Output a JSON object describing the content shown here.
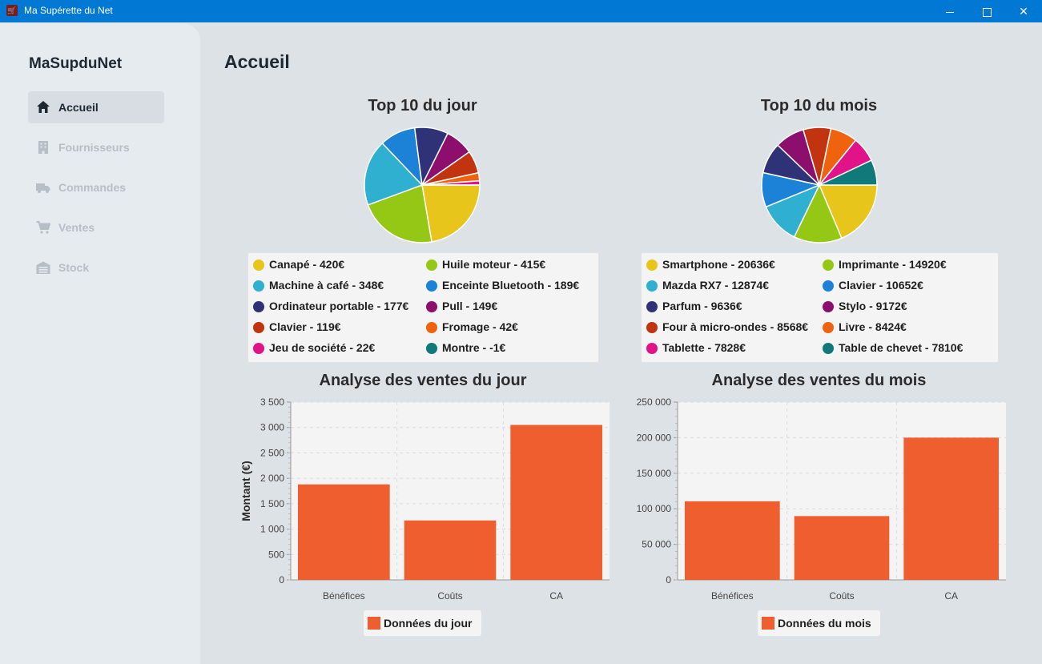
{
  "window": {
    "title": "Ma Supérette du Net"
  },
  "sidebar": {
    "brand": "MaSupduNet",
    "items": [
      {
        "label": "Accueil",
        "icon": "home-icon",
        "active": true
      },
      {
        "label": "Fournisseurs",
        "icon": "building-icon",
        "active": false
      },
      {
        "label": "Commandes",
        "icon": "truck-icon",
        "active": false
      },
      {
        "label": "Ventes",
        "icon": "cart-icon",
        "active": false
      },
      {
        "label": "Stock",
        "icon": "warehouse-icon",
        "active": false
      }
    ]
  },
  "main": {
    "title": "Accueil"
  },
  "colors": {
    "accent": "#0078d4",
    "bar": "#ef5e2e",
    "palette": [
      "#e8c51a",
      "#95c814",
      "#2fb0d0",
      "#1b82d8",
      "#2f3277",
      "#8c0f6e",
      "#c2340f",
      "#f0630e",
      "#e01488",
      "#10797a"
    ]
  },
  "pie_day": {
    "title": "Top 10 du jour",
    "legend": [
      "Canapé - 420€",
      "Huile moteur - 415€",
      "Machine à café - 348€",
      "Enceinte Bluetooth - 189€",
      "Ordinateur portable - 177€",
      "Pull - 149€",
      "Clavier - 119€",
      "Fromage - 42€",
      "Jeu de société - 22€",
      "Montre - -1€"
    ]
  },
  "pie_month": {
    "title": "Top 10 du mois",
    "legend": [
      "Smartphone - 20636€",
      "Imprimante - 14920€",
      "Mazda RX7 - 12874€",
      "Clavier - 10652€",
      "Parfum - 9636€",
      "Stylo - 9172€",
      "Four à micro-ondes - 8568€",
      "Livre - 8424€",
      "Tablette - 7828€",
      "Table de chevet - 7810€"
    ]
  },
  "bar_day": {
    "title": "Analyse des ventes du jour",
    "legend": "Données du jour",
    "ylabel": "Montant (€)",
    "ticks": [
      "0",
      "500",
      "1 000",
      "1 500",
      "2 000",
      "2 500",
      "3 000",
      "3 500"
    ]
  },
  "bar_month": {
    "title": "Analyse des ventes du mois",
    "legend": "Données du mois",
    "ticks": [
      "0",
      "50 000",
      "100 000",
      "150 000",
      "200 000",
      "250 000"
    ]
  },
  "chart_data": [
    {
      "type": "pie",
      "title": "Top 10 du jour",
      "categories": [
        "Canapé",
        "Huile moteur",
        "Machine à café",
        "Enceinte Bluetooth",
        "Ordinateur portable",
        "Pull",
        "Clavier",
        "Fromage",
        "Jeu de société",
        "Montre"
      ],
      "values": [
        420,
        415,
        348,
        189,
        177,
        149,
        119,
        42,
        22,
        -1
      ]
    },
    {
      "type": "pie",
      "title": "Top 10 du mois",
      "categories": [
        "Smartphone",
        "Imprimante",
        "Mazda RX7",
        "Clavier",
        "Parfum",
        "Stylo",
        "Four à micro-ondes",
        "Livre",
        "Tablette",
        "Table de chevet"
      ],
      "values": [
        20636,
        14920,
        12874,
        10652,
        9636,
        9172,
        8568,
        8424,
        7828,
        7810
      ]
    },
    {
      "type": "bar",
      "title": "Analyse des ventes du jour",
      "categories": [
        "Bénéfices",
        "Coûts",
        "CA"
      ],
      "series": [
        {
          "name": "Données du jour",
          "values": [
            1880,
            1170,
            3050
          ]
        }
      ],
      "ylabel": "Montant (€)",
      "ylim": [
        0,
        3500
      ],
      "grid": true,
      "legend": "bottom"
    },
    {
      "type": "bar",
      "title": "Analyse des ventes du mois",
      "categories": [
        "Bénéfices",
        "Coûts",
        "CA"
      ],
      "series": [
        {
          "name": "Données du mois",
          "values": [
            110500,
            89700,
            200000
          ]
        }
      ],
      "ylim": [
        0,
        250000
      ],
      "grid": true,
      "legend": "bottom"
    }
  ]
}
